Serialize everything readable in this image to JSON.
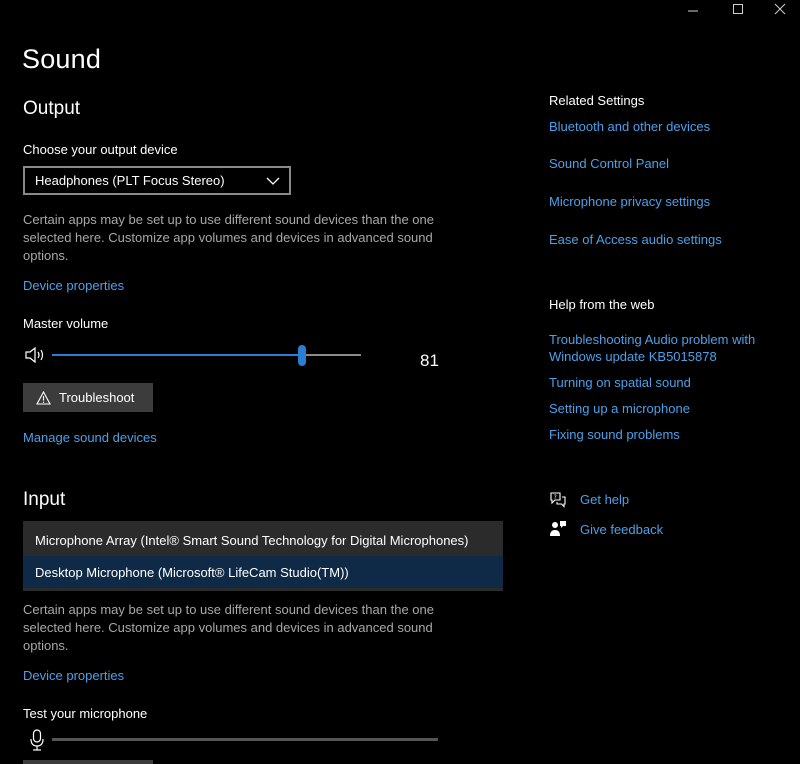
{
  "window": {
    "controls": [
      "minimize",
      "maximize",
      "close"
    ]
  },
  "page": {
    "title": "Sound"
  },
  "output": {
    "heading": "Output",
    "choose_label": "Choose your output device",
    "device_selected": "Headphones (PLT Focus Stereo)",
    "desc_line1": "Certain apps may be set up to use different sound devices than the one",
    "desc_line2": "selected here. Customize app volumes and devices in advanced sound",
    "desc_line3": "options.",
    "device_properties_link": "Device properties",
    "master_volume_label": "Master volume",
    "volume_value": "81",
    "volume_level": 81,
    "troubleshoot_label": "Troubleshoot",
    "manage_devices_link": "Manage sound devices"
  },
  "input": {
    "heading": "Input",
    "options": [
      "Microphone Array (Intel® Smart Sound Technology for Digital Microphones)",
      "Desktop Microphone (Microsoft® LifeCam Studio(TM))"
    ],
    "selected_index": 1,
    "desc_line1": "Certain apps may be set up to use different sound devices than the one",
    "desc_line2": "selected here. Customize app volumes and devices in advanced sound",
    "desc_line3": "options.",
    "device_properties_link": "Device properties",
    "test_label": "Test your microphone",
    "mic_level": 0
  },
  "related": {
    "heading": "Related Settings",
    "links": [
      "Bluetooth and other devices",
      "Sound Control Panel",
      "Microphone privacy settings",
      "Ease of Access audio settings"
    ]
  },
  "help": {
    "heading": "Help from the web",
    "link1_line1": "Troubleshooting Audio problem with",
    "link1_line2": "Windows update KB5015878",
    "link2": "Turning on spatial sound",
    "link3": "Setting up a microphone",
    "link4": "Fixing sound problems"
  },
  "support": {
    "get_help": "Get help",
    "give_feedback": "Give feedback"
  },
  "colors": {
    "background": "#000000",
    "link": "#4ca0e8",
    "accent": "#2a7fd4",
    "selected_item": "#0f2a46"
  },
  "icons": [
    "minimize-icon",
    "maximize-icon",
    "close-icon",
    "chevron-down-icon",
    "speaker-icon",
    "warning-icon",
    "chat-help-icon",
    "feedback-icon",
    "microphone-icon"
  ]
}
